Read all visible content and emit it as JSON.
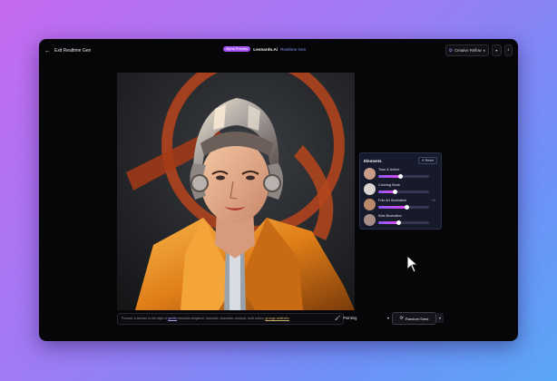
{
  "topbar": {
    "exit_label": "Exit Realtime Gen",
    "badge": "Alpha Preview",
    "app_name": "Leonardo.Ai",
    "mode": "Realtime Gen",
    "right_button": "Creative Reflow",
    "icons": [
      "back-arrow-icon",
      "gear-icon",
      "toggle-icon",
      "chevron-down-icon",
      "download-icon"
    ]
  },
  "elements_panel": {
    "title": "Elements",
    "reset_label": "Reset",
    "items": [
      {
        "name": "Toon & Anime",
        "weight": "",
        "level": 0.42,
        "thumb_color": "#c89b8a"
      },
      {
        "name": "Coloring Book",
        "weight": "",
        "level": 0.33,
        "thumb_color": "#d8d4cf"
      },
      {
        "name": "Folk Art Illustration",
        "weight": "+1",
        "level": 0.55,
        "thumb_color": "#b98a68"
      },
      {
        "name": "Kids Illustration",
        "weight": "",
        "level": 0.4,
        "thumb_color": "#a58d86"
      }
    ]
  },
  "prompt": {
    "text_plain": "Portrait, a woman in the style of ",
    "text_underlined": "gentle",
    "text_mid": " futuristic elegance, futuristic, character concept, bold colors, ",
    "text_orange": "grunge aesthetic"
  },
  "controls": {
    "style_label": "Painting",
    "random_label": "Random Seed"
  }
}
